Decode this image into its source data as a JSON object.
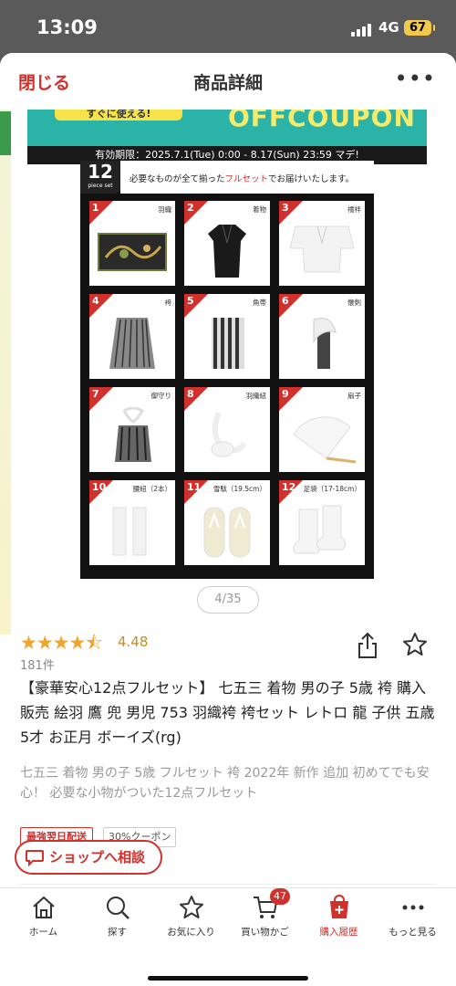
{
  "status_bar": {
    "time": "13:09",
    "network": "4G",
    "battery": "67"
  },
  "header": {
    "close_label": "閉じる",
    "title": "商品詳細",
    "more_label": "•••"
  },
  "coupon": {
    "headline": "OFFCOUPON",
    "strip_text": "すぐに使える!",
    "validity": "有効期限：2025.7.1(Tue) 0:00 - 8.17(Sun) 23:59 マデ!"
  },
  "product_image": {
    "set_count": "12",
    "set_sub": "piece set",
    "caption_before": "必要なものが全て揃った",
    "caption_highlight": "フルセット",
    "caption_after": "でお届けいたします。",
    "items": [
      {
        "no": "1",
        "label": "羽織"
      },
      {
        "no": "2",
        "label": "着物"
      },
      {
        "no": "3",
        "label": "襦袢"
      },
      {
        "no": "4",
        "label": "袴"
      },
      {
        "no": "5",
        "label": "角帯"
      },
      {
        "no": "6",
        "label": "懐剣"
      },
      {
        "no": "7",
        "label": "御守り"
      },
      {
        "no": "8",
        "label": "羽織紐"
      },
      {
        "no": "9",
        "label": "扇子"
      },
      {
        "no": "10",
        "label": "腰紐（2本）"
      },
      {
        "no": "11",
        "label": "雪駄（19.5cm）"
      },
      {
        "no": "12",
        "label": "足袋（17-18cm）"
      }
    ]
  },
  "page_indicator": "4/35",
  "rating": {
    "stars": "★★★★⯪",
    "value": "4.48",
    "review_count": "181件"
  },
  "product": {
    "title": "【豪華安心12点フルセット】 七五三 着物 男の子 5歳 袴 購入 販売 絵羽 鷹 兜 男児 753 羽織袴 袴セット レトロ 龍 子供 五歳 5才 お正月 ボーイズ(rg)",
    "catch_copy": "七五三 着物 男の子 5歳 フルセット 袴 2022年 新作 追加 初めてでも安心！ 必要な小物がついた12点フルセット"
  },
  "badges": {
    "shipping": "最強翌日配送",
    "coupon": "30%クーポン"
  },
  "shop_consult": "ショップへ相談",
  "nav": {
    "home": "ホーム",
    "search": "探す",
    "favorites": "お気に入り",
    "cart": "買い物かご",
    "cart_count": "47",
    "history": "購入履歴",
    "more": "もっと見る"
  },
  "colors": {
    "accent": "#d0312d",
    "star": "#f0a530",
    "coupon_bg": "#2bb3a8"
  }
}
